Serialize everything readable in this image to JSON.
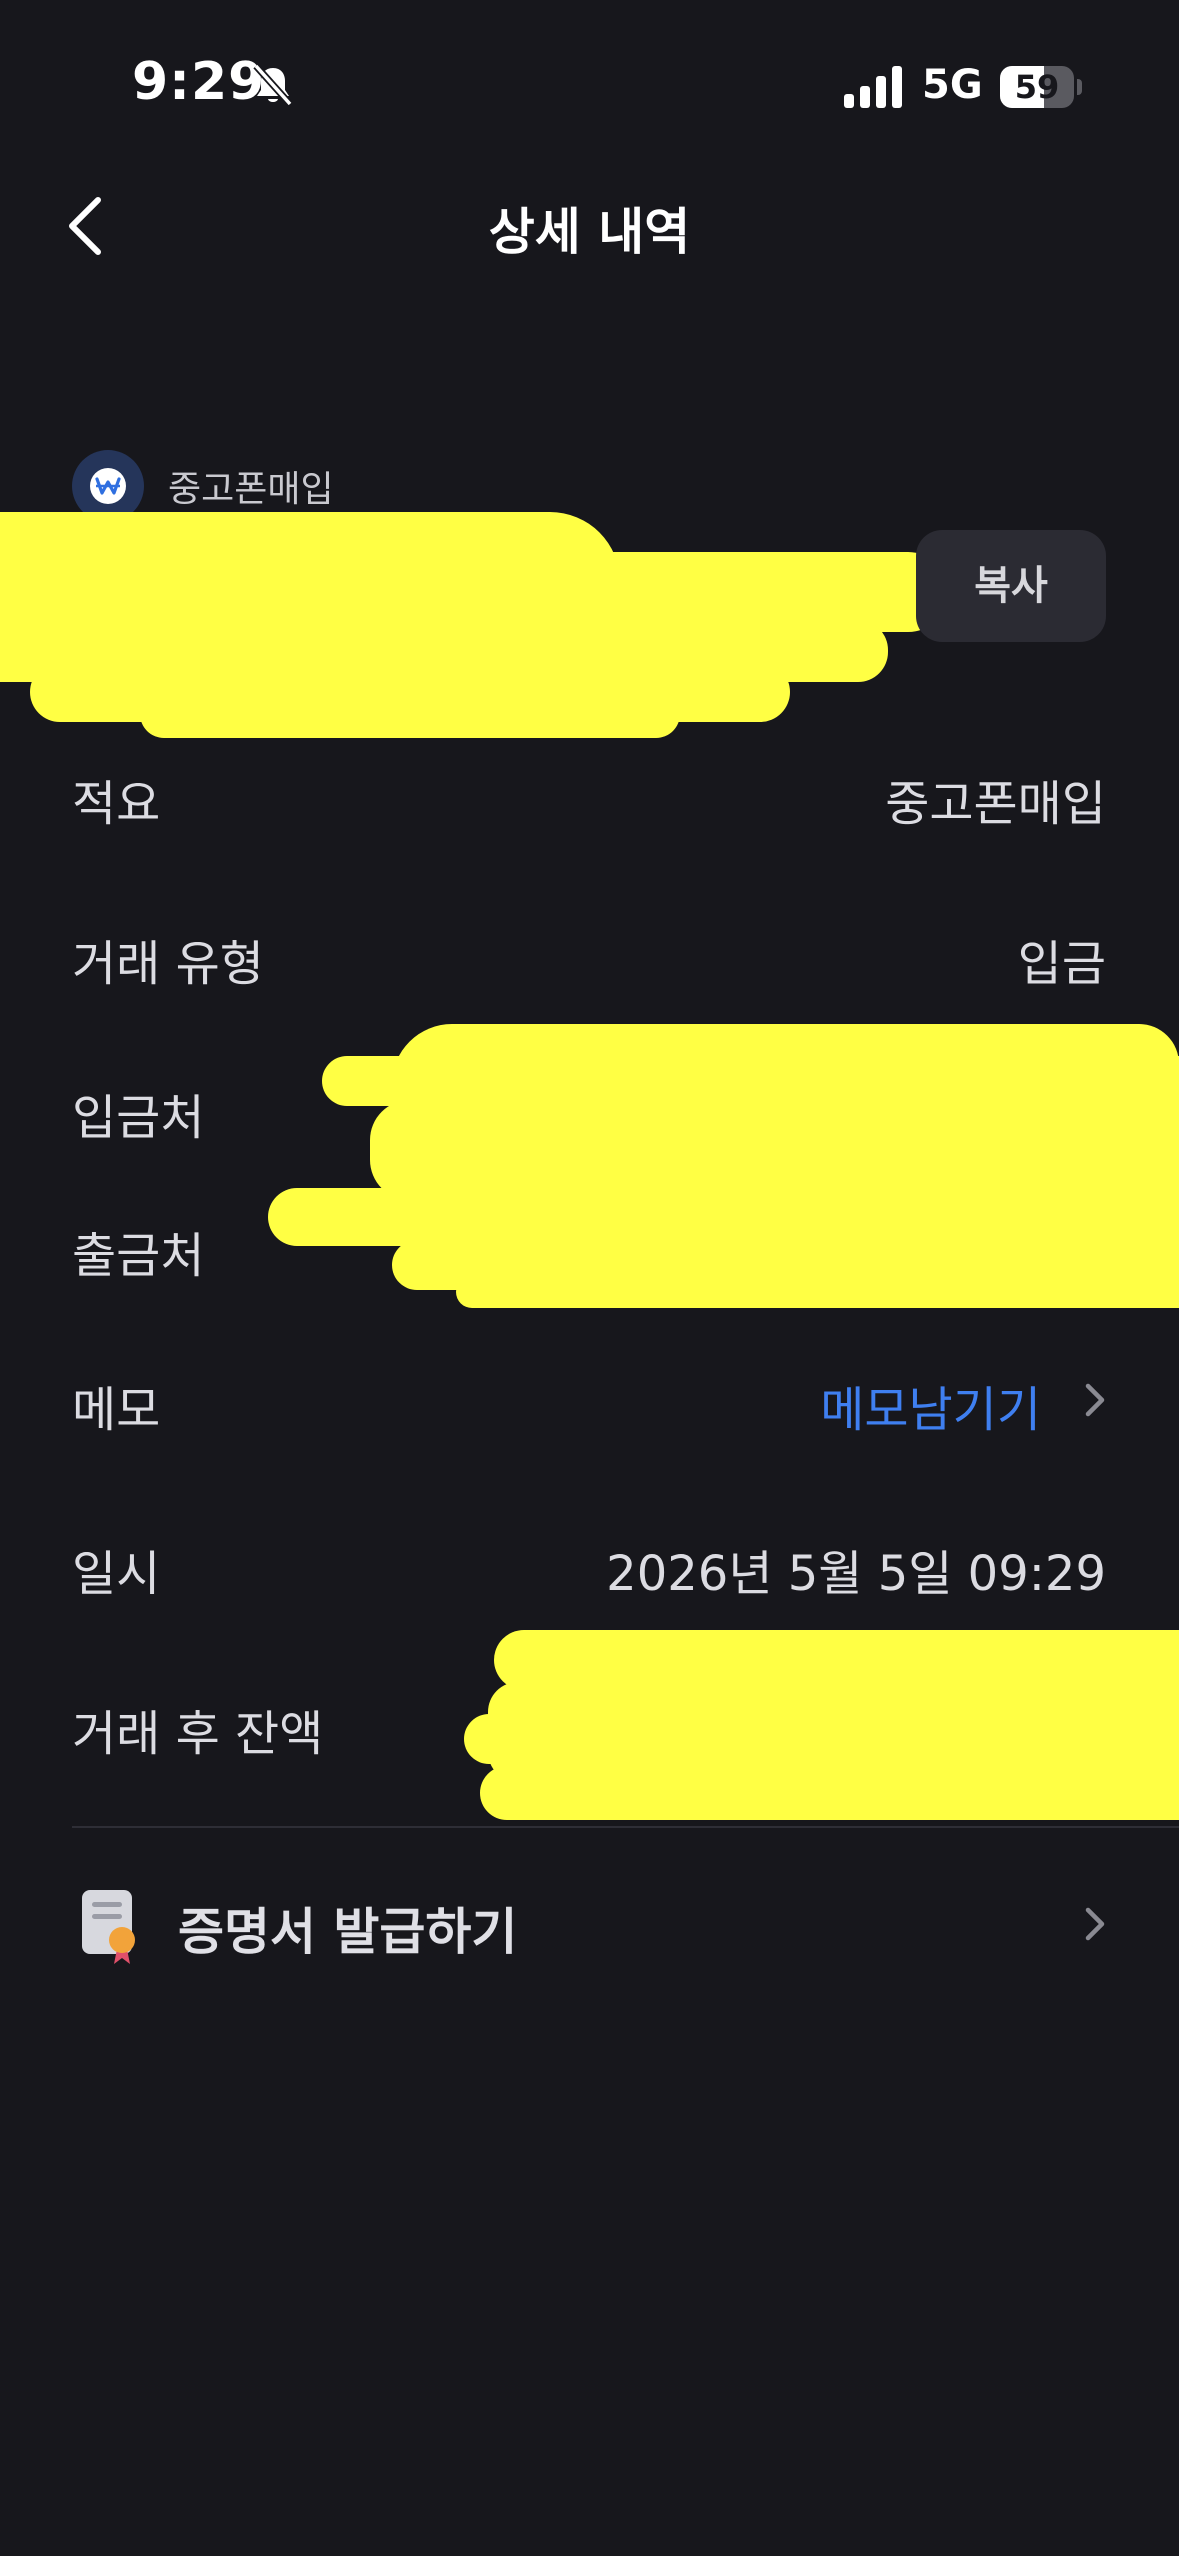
{
  "status_bar": {
    "time": "9:29",
    "network": "5G",
    "battery": "59",
    "battery_level": 0.59
  },
  "nav": {
    "title": "상세 내역"
  },
  "account": {
    "caption": "중고폰매입",
    "copy_label": "복사"
  },
  "rows": {
    "memo_summary": {
      "label": "적요",
      "value": "중고폰매입"
    },
    "transaction_type": {
      "label": "거래 유형",
      "value": "입금"
    },
    "deposit_to": {
      "label": "입금처"
    },
    "withdraw_from": {
      "label": "출금처"
    },
    "memo": {
      "label": "메모",
      "action": "메모남기기"
    },
    "datetime": {
      "label": "일시",
      "value": "2026년 5월 5일 09:29"
    },
    "balance_after": {
      "label": "거래 후 잔액"
    }
  },
  "certificate": {
    "label": "증명서 발급하기"
  },
  "colors": {
    "background": "#17171c",
    "accent_link": "#3f7ff0",
    "redaction": "#ffff44"
  }
}
